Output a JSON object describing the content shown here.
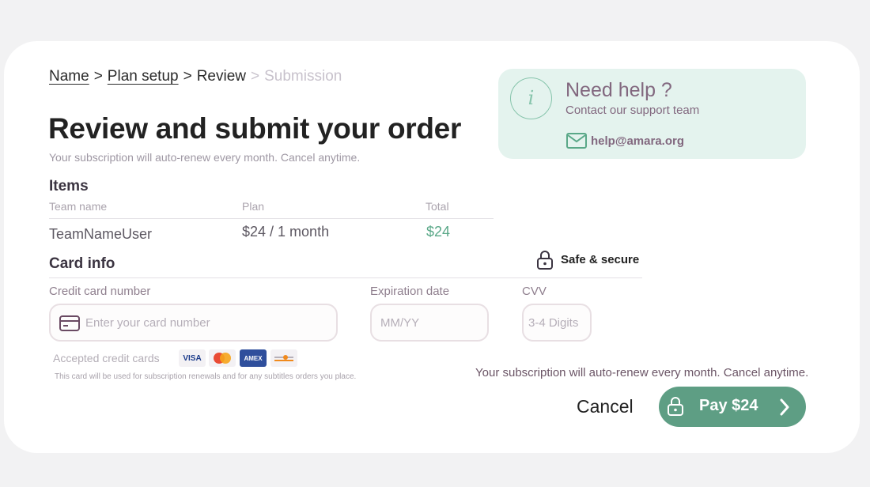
{
  "breadcrumb": {
    "step1": "Name",
    "step2": "Plan setup",
    "step3": "Review",
    "step4": "Submission",
    "separator": ">"
  },
  "header": {
    "title": "Review and submit your order",
    "subtitle": "Your subscription will auto-renew every month. Cancel anytime."
  },
  "help": {
    "title": "Need help ?",
    "subtitle": "Contact our support team",
    "email": "help@amara.org",
    "accent_color": "#86c4ab"
  },
  "items": {
    "section_title": "Items",
    "columns": [
      "Team name",
      "Plan",
      "Total"
    ],
    "row": {
      "team_name": "TeamNameUser",
      "plan": "$24 / 1 month",
      "total": "$24"
    }
  },
  "card_info": {
    "section_title": "Card info",
    "safe_label": "Safe & secure",
    "card_number": {
      "label": "Credit card number",
      "placeholder": "Enter your card number",
      "value": ""
    },
    "expiration": {
      "label": "Expiration date",
      "placeholder": "MM/YY",
      "value": ""
    },
    "cvv": {
      "label": "CVV",
      "placeholder": "3-4 Digits",
      "value": ""
    },
    "accepted_label": "Accepted credit cards",
    "accepted_cards": [
      {
        "name": "visa",
        "text": "VISA"
      },
      {
        "name": "mastercard",
        "text": ""
      },
      {
        "name": "amex",
        "text": "AMEX"
      },
      {
        "name": "discover",
        "text": ""
      }
    ],
    "note": "This card will be used for subscription renewals and for any subtitles orders you place."
  },
  "footer": {
    "renew_note": "Your subscription will auto-renew every month. Cancel anytime.",
    "cancel_label": "Cancel",
    "pay_label": "Pay $24",
    "pay_color": "#5e9e84"
  }
}
